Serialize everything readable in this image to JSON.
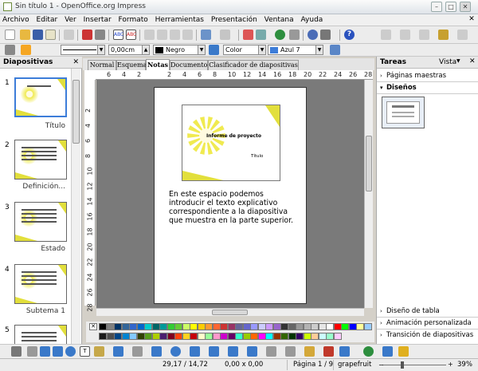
{
  "window": {
    "title": "Sin título 1 - OpenOffice.org Impress"
  },
  "menu": [
    "Archivo",
    "Editar",
    "Ver",
    "Insertar",
    "Formato",
    "Herramientas",
    "Presentación",
    "Ventana",
    "Ayuda"
  ],
  "format_bar": {
    "line_width": "0,00cm",
    "line_color": "Negro",
    "fill_type": "Color",
    "fill_color": "Azul 7"
  },
  "slides_panel": {
    "title": "Diapositivas",
    "slides": [
      {
        "num": "1",
        "label": "Título"
      },
      {
        "num": "2",
        "label": "Definición..."
      },
      {
        "num": "3",
        "label": "Estado"
      },
      {
        "num": "4",
        "label": "Subtema 1"
      },
      {
        "num": "5",
        "label": ""
      }
    ]
  },
  "view_tabs": [
    "Normal",
    "Esquema",
    "Notas",
    "Documento",
    "Clasificador de diapositivas"
  ],
  "active_tab": "Notas",
  "ruler": {
    "h_labels": [
      "6",
      "4",
      "2",
      "",
      "2",
      "4",
      "6",
      "8",
      "10",
      "12",
      "14",
      "16",
      "18",
      "20",
      "22",
      "24",
      "26",
      "28"
    ],
    "v_labels": [
      "2",
      "4",
      "6",
      "8",
      "10",
      "12",
      "14",
      "16",
      "18",
      "20",
      "22",
      "24",
      "26",
      "28"
    ]
  },
  "slide_preview": {
    "title": "Informe de proyecto",
    "subtitle": "Título"
  },
  "notes_text": "En este espacio podemos introducir el texto explicativo correspondiente a la diapositiva que muestra en la parte superior.",
  "task_panel": {
    "title": "Tareas",
    "view_label": "Vista",
    "sections_top": [
      {
        "label": "Páginas maestras",
        "expanded": false
      },
      {
        "label": "Diseños",
        "expanded": true
      }
    ],
    "sections_bottom": [
      {
        "label": "Diseño de tabla"
      },
      {
        "label": "Animación personalizada"
      },
      {
        "label": "Transición de diapositivas"
      }
    ]
  },
  "status": {
    "position": "29,17 / 14,72",
    "size": "0,00 x 0,00",
    "page": "Página 1 / 9",
    "master": "grapefruit",
    "zoom": "39%"
  },
  "palette_colors": [
    "#000000",
    "#808080",
    "#003366",
    "#336699",
    "#3366cc",
    "#0066cc",
    "#00cccc",
    "#006666",
    "#009999",
    "#33cc33",
    "#66cc33",
    "#ccff66",
    "#ffff00",
    "#ffcc00",
    "#ff9933",
    "#ff6633",
    "#cc3333",
    "#993366",
    "#666699",
    "#6666cc",
    "#9999ff",
    "#ccccff",
    "#cc99ff",
    "#9966cc",
    "#333333",
    "#666666",
    "#999999",
    "#b3b3b3",
    "#cccccc",
    "#e6e6e6",
    "#ffffff",
    "#ff0000",
    "#00ff00",
    "#0000ff",
    "#ffff99",
    "#99ccff",
    "#1a1a1a",
    "#4d4d4d",
    "#004586",
    "#0084d1",
    "#83caff",
    "#314004",
    "#579d1c",
    "#aecf00",
    "#4b1f6f",
    "#7e0021",
    "#ff420e",
    "#ffd320",
    "#c5000b",
    "#ffffcc",
    "#99ff99",
    "#ff99cc",
    "#cc00cc",
    "#660066",
    "#33ffcc",
    "#99cc00",
    "#ff6600",
    "#ff00ff",
    "#00ffff",
    "#993300",
    "#336600",
    "#003300",
    "#330066",
    "#ccff00",
    "#ffcc99",
    "#ccffff",
    "#99ffcc",
    "#ffccff"
  ]
}
